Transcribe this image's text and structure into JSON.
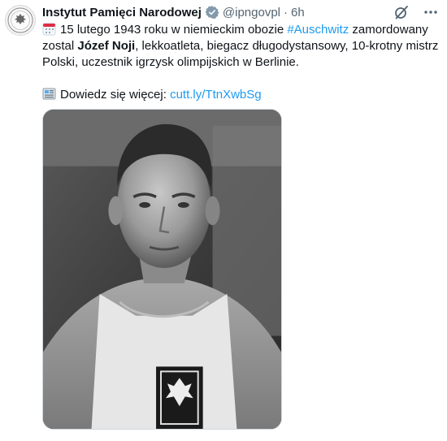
{
  "account": {
    "display_name": "Instytut Pamięci Narodowej",
    "handle": "@ipngovpl",
    "separator": "·",
    "time": "6h",
    "avatar_icon": "ipn-emblem-icon",
    "verified_color": "#829aab"
  },
  "tweet": {
    "calendar_icon": "calendar-emoji-icon",
    "line1_pre": "15 lutego 1943 roku w niemieckim obozie ",
    "hashtag": "#Auschwitz",
    "line1_post": " zamordowany zostal ",
    "name_bold": "Józef Noji",
    "line1_rest": ", lekkoatleta, biegacz długodystansowy, 10-krotny mistrz Polski, uczestnik igrzysk olimpijskich w Berlinie.",
    "newspaper_icon": "newspaper-emoji-icon",
    "more_label": "Dowiedz się więcej: ",
    "link": "cutt.ly/TtnXwbSg"
  },
  "colors": {
    "link": "#1d9bf0",
    "secondary_text": "#536471",
    "primary_text": "#0f1419"
  },
  "media": {
    "type": "photo",
    "style": "black-and-white",
    "subject_icon": "runner-portrait-photo"
  },
  "actions": {
    "grok_icon": "grok-icon",
    "more_icon": "more-horizontal-icon"
  }
}
